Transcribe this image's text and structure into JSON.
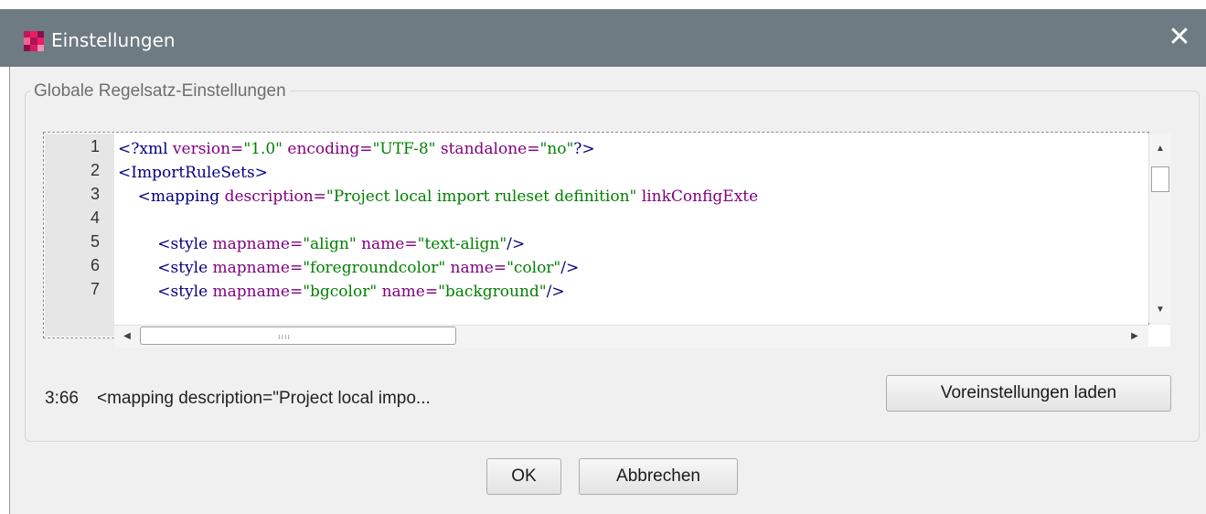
{
  "window": {
    "title": "Einstellungen",
    "close_glyph": "✕",
    "icon": "app-logo-icon",
    "titlebar_color": "#6e7b82"
  },
  "group": {
    "legend": "Globale Regelsatz-Einstellungen"
  },
  "editor": {
    "line_numbers": [
      "1",
      "2",
      "3",
      "4",
      "5",
      "6",
      "7"
    ],
    "lines": [
      [
        {
          "t": "<?xml ",
          "c": "tag"
        },
        {
          "t": "version=",
          "c": "attr"
        },
        {
          "t": "\"1.0\" ",
          "c": "val"
        },
        {
          "t": "encoding=",
          "c": "attr"
        },
        {
          "t": "\"UTF-8\" ",
          "c": "val"
        },
        {
          "t": "standalone=",
          "c": "attr"
        },
        {
          "t": "\"no\"",
          "c": "val"
        },
        {
          "t": "?>",
          "c": "tag"
        }
      ],
      [
        {
          "t": "<ImportRuleSets>",
          "c": "tag"
        }
      ],
      [
        {
          "t": "    <mapping ",
          "c": "tag"
        },
        {
          "t": "description=",
          "c": "attr"
        },
        {
          "t": "\"Project local import ruleset definition\" ",
          "c": "val"
        },
        {
          "t": "linkConfigExte",
          "c": "attr"
        }
      ],
      [],
      [
        {
          "t": "        <style ",
          "c": "tag"
        },
        {
          "t": "mapname=",
          "c": "attr"
        },
        {
          "t": "\"align\" ",
          "c": "val"
        },
        {
          "t": "name=",
          "c": "attr"
        },
        {
          "t": "\"text-align\"",
          "c": "val"
        },
        {
          "t": "/>",
          "c": "tag"
        }
      ],
      [
        {
          "t": "        <style ",
          "c": "tag"
        },
        {
          "t": "mapname=",
          "c": "attr"
        },
        {
          "t": "\"foregroundcolor\" ",
          "c": "val"
        },
        {
          "t": "name=",
          "c": "attr"
        },
        {
          "t": "\"color\"",
          "c": "val"
        },
        {
          "t": "/>",
          "c": "tag"
        }
      ],
      [
        {
          "t": "        <style ",
          "c": "tag"
        },
        {
          "t": "mapname=",
          "c": "attr"
        },
        {
          "t": "\"bgcolor\" ",
          "c": "val"
        },
        {
          "t": "name=",
          "c": "attr"
        },
        {
          "t": "\"background\"",
          "c": "val"
        },
        {
          "t": "/>",
          "c": "tag"
        }
      ]
    ],
    "colors": {
      "tag": "#000080",
      "attr": "#800080",
      "val": "#008000"
    }
  },
  "status": {
    "cursor_position": "3:66",
    "element_preview": "<mapping description=\"Project local impo..."
  },
  "buttons": {
    "load_defaults": "Voreinstellungen laden",
    "ok": "OK",
    "cancel": "Abbrechen"
  }
}
